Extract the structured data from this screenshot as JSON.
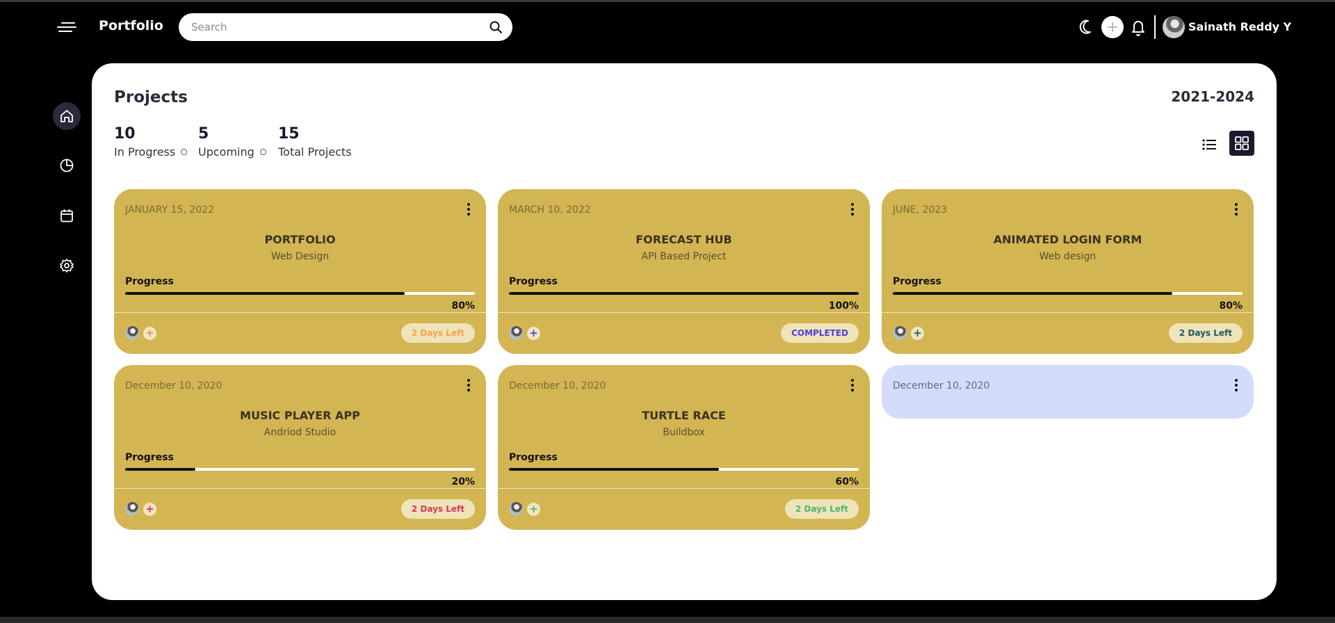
{
  "header": {
    "brand": "Portfolio",
    "search_placeholder": "Search",
    "user_name": "Sainath Reddy Y"
  },
  "sidenav": {
    "items": [
      {
        "icon": "home-icon",
        "active": true
      },
      {
        "icon": "pie-chart-icon",
        "active": false
      },
      {
        "icon": "calendar-icon",
        "active": false
      },
      {
        "icon": "settings-icon",
        "active": false
      }
    ]
  },
  "projects": {
    "title": "Projects",
    "years": "2021-2024",
    "stats": [
      {
        "num": "10",
        "label": "In Progress"
      },
      {
        "num": "5",
        "label": "Upcoming"
      },
      {
        "num": "15",
        "label": "Total Projects"
      }
    ],
    "progress_label": "Progress",
    "cards": [
      {
        "date": "JANUARY 15, 2022",
        "title": "PORTFOLIO",
        "subtitle": "Web Design",
        "progress": 0.8,
        "progress_text": "80%",
        "badge": "2 Days Left",
        "badge_color": "#f4a24c",
        "add_color": "#e8944a"
      },
      {
        "date": "MARCH 10, 2022",
        "title": "FORECAST HUB",
        "subtitle": "API Based Project",
        "progress": 1.0,
        "progress_text": "100%",
        "badge": "COMPLETED",
        "badge_color": "#4a3ee0",
        "add_color": "#4a3ee0"
      },
      {
        "date": "JUNE, 2023",
        "title": "ANIMATED LOGIN FORM",
        "subtitle": "Web design",
        "progress": 0.8,
        "progress_text": "80%",
        "badge": "2 Days Left",
        "badge_color": "#1f5a5a",
        "add_color": "#1f5a5a"
      },
      {
        "date": "December 10, 2020",
        "title": "MUSIC PLAYER APP",
        "subtitle": "Andriod Studio",
        "progress": 0.2,
        "progress_text": "20%",
        "badge": "2 Days Left",
        "badge_color": "#d8365a",
        "add_color": "#d8365a"
      },
      {
        "date": "December 10, 2020",
        "title": "TURTLE RACE",
        "subtitle": "Buildbox",
        "progress": 0.6,
        "progress_text": "60%",
        "badge": "2 Days Left",
        "badge_color": "#4cb86a",
        "add_color": "#4cb86a"
      },
      {
        "date": "December 10, 2020"
      }
    ],
    "card_color": "#d3b553",
    "partial_card_color": "#d4dcfb"
  }
}
